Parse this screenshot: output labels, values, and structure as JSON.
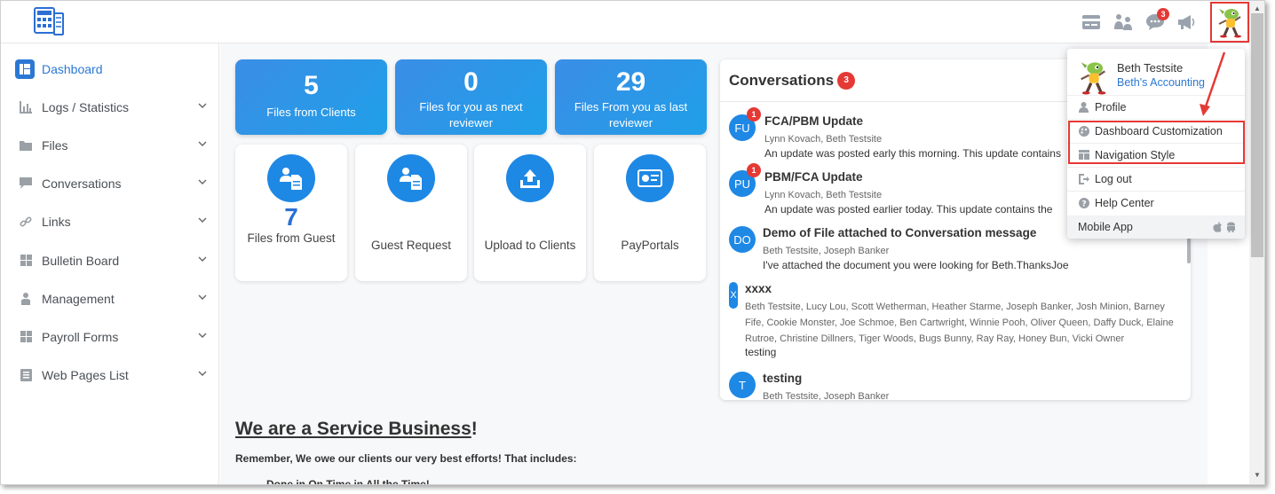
{
  "app": {
    "logo_icon": "app-logo-icon",
    "accent": "#2b78d4",
    "badge_color": "#e53935"
  },
  "topbar": {
    "icons": [
      "card-icon",
      "users-icon",
      "chat-icon",
      "megaphone-icon"
    ],
    "chat_badge": "3",
    "avatar_icon": "user-avatar-icon"
  },
  "sidebar": {
    "items": [
      {
        "label": "Dashboard",
        "icon": "dashboard-icon",
        "active": true
      },
      {
        "label": "Logs / Statistics",
        "icon": "chart-icon"
      },
      {
        "label": "Files",
        "icon": "folder-icon"
      },
      {
        "label": "Conversations",
        "icon": "chat-icon"
      },
      {
        "label": "Links",
        "icon": "link-icon"
      },
      {
        "label": "Bulletin Board",
        "icon": "board-icon"
      },
      {
        "label": "Management",
        "icon": "person-icon"
      },
      {
        "label": "Payroll Forms",
        "icon": "grid-icon"
      },
      {
        "label": "Web Pages List",
        "icon": "list-icon"
      }
    ]
  },
  "stats": [
    {
      "value": "5",
      "label": "Files from Clients"
    },
    {
      "value": "0",
      "label": "Files for you as next reviewer"
    },
    {
      "value": "29",
      "label": "Files From you as last reviewer"
    }
  ],
  "tiles": [
    {
      "value": "7",
      "label": "Files from Guest",
      "icon": "guest-file-icon"
    },
    {
      "label": "Guest Request",
      "icon": "guest-request-icon"
    },
    {
      "label": "Upload to Clients",
      "icon": "upload-icon"
    },
    {
      "label": "PayPortals",
      "icon": "payportal-icon"
    }
  ],
  "conversations": {
    "title": "Conversations",
    "count": "3",
    "items": [
      {
        "initials": "FU",
        "unread": "1",
        "title": "FCA/PBM Update",
        "people": "Lynn Kovach, Beth Testsite",
        "message": "An update was posted early this morning.  This update contains"
      },
      {
        "initials": "PU",
        "unread": "1",
        "title": "PBM/FCA Update",
        "people": "Lynn Kovach, Beth Testsite",
        "message": "An update was posted earlier today.  This update contains the"
      },
      {
        "initials": "DO",
        "title": "Demo of File attached to Conversation message",
        "people": "Beth Testsite, Joseph Banker",
        "message": "I've attached the document you were looking for Beth.ThanksJoe"
      },
      {
        "initials": "X",
        "title": "xxxx",
        "people": "Beth Testsite, Lucy Lou, Scott Wetherman, Heather Starme, Joseph Banker, Josh Minion, Barney Fife, Cookie Monster, Joe Schmoe, Ben Cartwright, Winnie Pooh, Oliver Queen, Daffy Duck, Elaine Rutroe, Christine Dillners, Tiger Woods, Bugs Bunny, Ray Ray, Honey Bun, Vicki Owner",
        "message": "testing"
      },
      {
        "initials": "T",
        "title": "testing",
        "people": "Beth Testsite, Joseph Banker",
        "message": ""
      }
    ]
  },
  "service": {
    "title": "We are a Service Business",
    "exclaim": "!",
    "subtitle": "Remember, We owe our clients our very best efforts! That includes:",
    "cut_line": "Done in On Time in All the Time!"
  },
  "user_menu": {
    "name": "Beth Testsite",
    "company": "Beth's Accounting",
    "items": [
      {
        "label": "Profile",
        "icon": "person-icon"
      },
      {
        "label": "Dashboard Customization",
        "icon": "palette-icon"
      },
      {
        "label": "Navigation Style",
        "icon": "layout-icon"
      },
      {
        "label": "Log out",
        "icon": "logout-icon"
      },
      {
        "label": "Help Center",
        "icon": "help-icon"
      }
    ],
    "mobile_label": "Mobile App",
    "mobile_icons": [
      "apple-icon",
      "android-icon"
    ]
  }
}
